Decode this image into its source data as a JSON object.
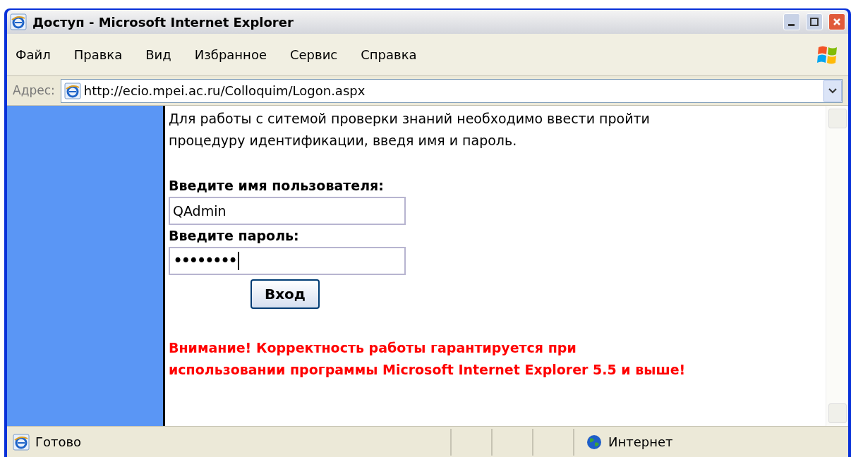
{
  "window": {
    "title": "Доступ - Microsoft Internet Explorer"
  },
  "menu": [
    "Файл",
    "Правка",
    "Вид",
    "Избранное",
    "Сервис",
    "Справка"
  ],
  "address": {
    "label": "Адрес:",
    "url": "http://ecio.mpei.ac.ru/Colloquim/Logon.aspx"
  },
  "page": {
    "intro": [
      "Для работы с ситемой проверки знаний необходимо ввести пройти",
      "процедуру идентификации, введя имя и пароль."
    ],
    "username_label": "Введите имя пользователя:",
    "username": "QAdmin",
    "password_label": "Введите пароль:",
    "password": "••••••••",
    "login_button": "Вход",
    "warning": [
      "Внимание! Корректность работы гарантируется при",
      "использовании программы Microsoft Internet Explorer 5.5 и выше!"
    ]
  },
  "status_bar": {
    "status": "Готово",
    "zone": "Интернет"
  }
}
